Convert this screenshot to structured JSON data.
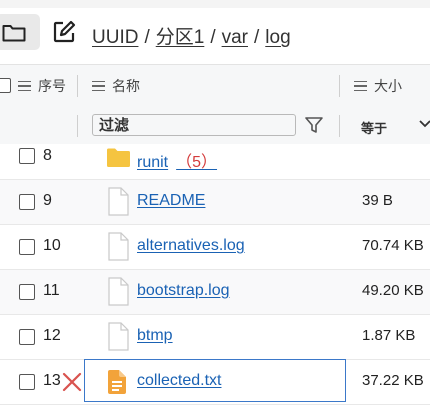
{
  "breadcrumb": {
    "items": [
      "UUID",
      "分区1",
      "var",
      "log"
    ],
    "separator": "/"
  },
  "table": {
    "headers": {
      "index": "序号",
      "name": "名称",
      "size": "大小"
    },
    "filter": {
      "placeholder": "过滤",
      "operator": "等于"
    },
    "rows": [
      {
        "index": "8",
        "name": "runit",
        "count": "（5）",
        "type": "folder",
        "size": ""
      },
      {
        "index": "9",
        "name": "README",
        "type": "file",
        "size": "39 B"
      },
      {
        "index": "10",
        "name": "alternatives.log",
        "type": "file",
        "size": "70.74 KB"
      },
      {
        "index": "11",
        "name": "bootstrap.log",
        "type": "file",
        "size": "49.20 KB"
      },
      {
        "index": "12",
        "name": "btmp",
        "type": "file",
        "size": "1.87 KB"
      },
      {
        "index": "13",
        "name": "collected.txt",
        "type": "text-file",
        "size": "37.22 KB"
      }
    ]
  },
  "icons": {
    "folder": "folder-icon",
    "edit": "edit-icon",
    "file": "file-icon",
    "text-file": "text-file-icon",
    "delete": "close-icon",
    "filter": "filter-icon",
    "dropdown": "chevron-down-icon"
  },
  "colors": {
    "link": "#1a62b4",
    "folder": "#f5c440",
    "text_file": "#f2a33a",
    "delete": "#d9534f",
    "selection": "#3b78c9",
    "count": "#d43c3c"
  }
}
